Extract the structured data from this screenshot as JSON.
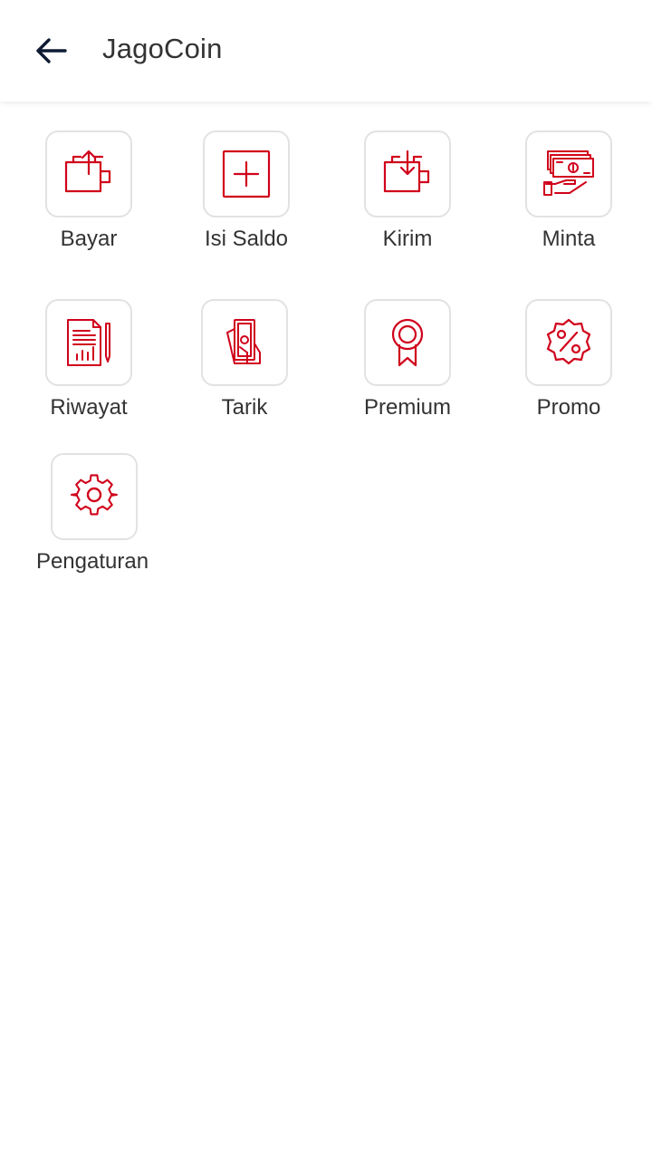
{
  "appbar": {
    "title": "JagoCoin",
    "back_icon": "arrow-left-icon"
  },
  "colors": {
    "accent": "#d0021b",
    "text": "#333333",
    "tile_border": "#e2e2e2",
    "back_icon": "#0f1b33"
  },
  "menu": {
    "items": [
      {
        "label": "Bayar",
        "icon": "wallet-upload-icon"
      },
      {
        "label": "Isi Saldo",
        "icon": "add-square-icon"
      },
      {
        "label": "Kirim",
        "icon": "wallet-download-icon"
      },
      {
        "label": "Minta",
        "icon": "hand-money-icon"
      },
      {
        "label": "Riwayat",
        "icon": "report-document-icon"
      },
      {
        "label": "Tarik",
        "icon": "cash-withdraw-icon"
      },
      {
        "label": "Premium",
        "icon": "badge-ribbon-icon"
      },
      {
        "label": "Promo",
        "icon": "percent-badge-icon"
      },
      {
        "label": "Pengaturan",
        "icon": "gear-icon"
      }
    ]
  }
}
